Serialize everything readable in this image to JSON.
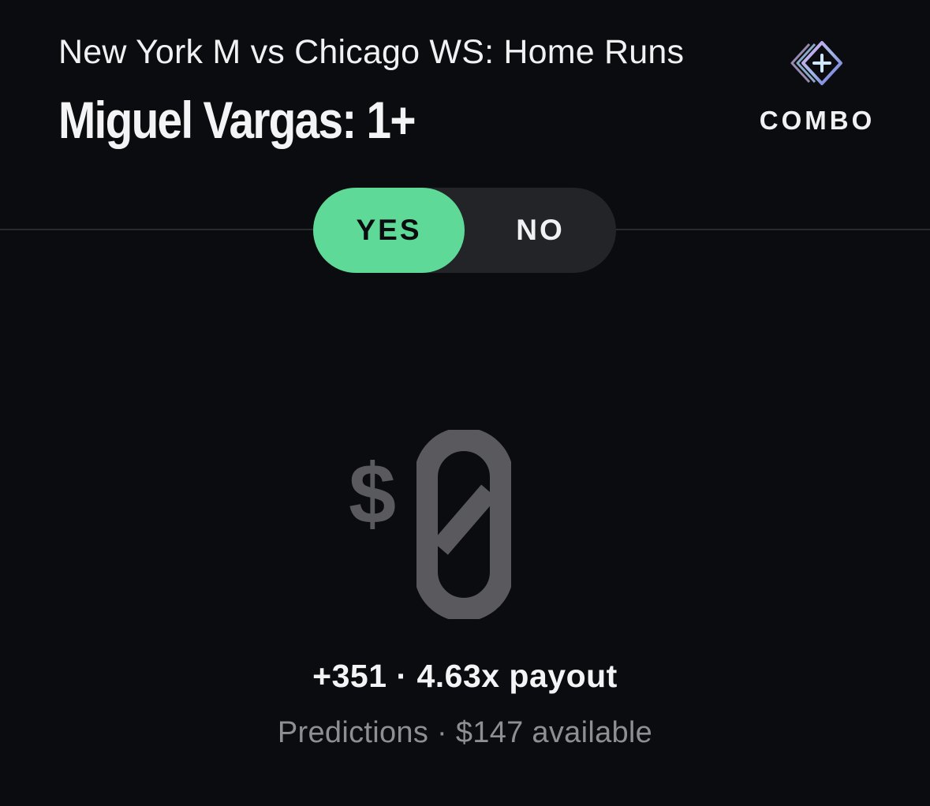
{
  "header": {
    "market_title": "New York M vs Chicago WS: Home Runs",
    "selection_title": "Miguel Vargas: 1+"
  },
  "combo": {
    "label": "COMBO",
    "icon": "combo-diamond-plus-icon"
  },
  "toggle": {
    "yes_label": "YES",
    "no_label": "NO",
    "selected": "YES",
    "yes_color": "#5fd997",
    "track_color": "#232427"
  },
  "wager": {
    "currency": "$",
    "amount": "0"
  },
  "payout": {
    "text": "+351 · 4.63x payout"
  },
  "balance": {
    "text": "Predictions · $147 available"
  }
}
